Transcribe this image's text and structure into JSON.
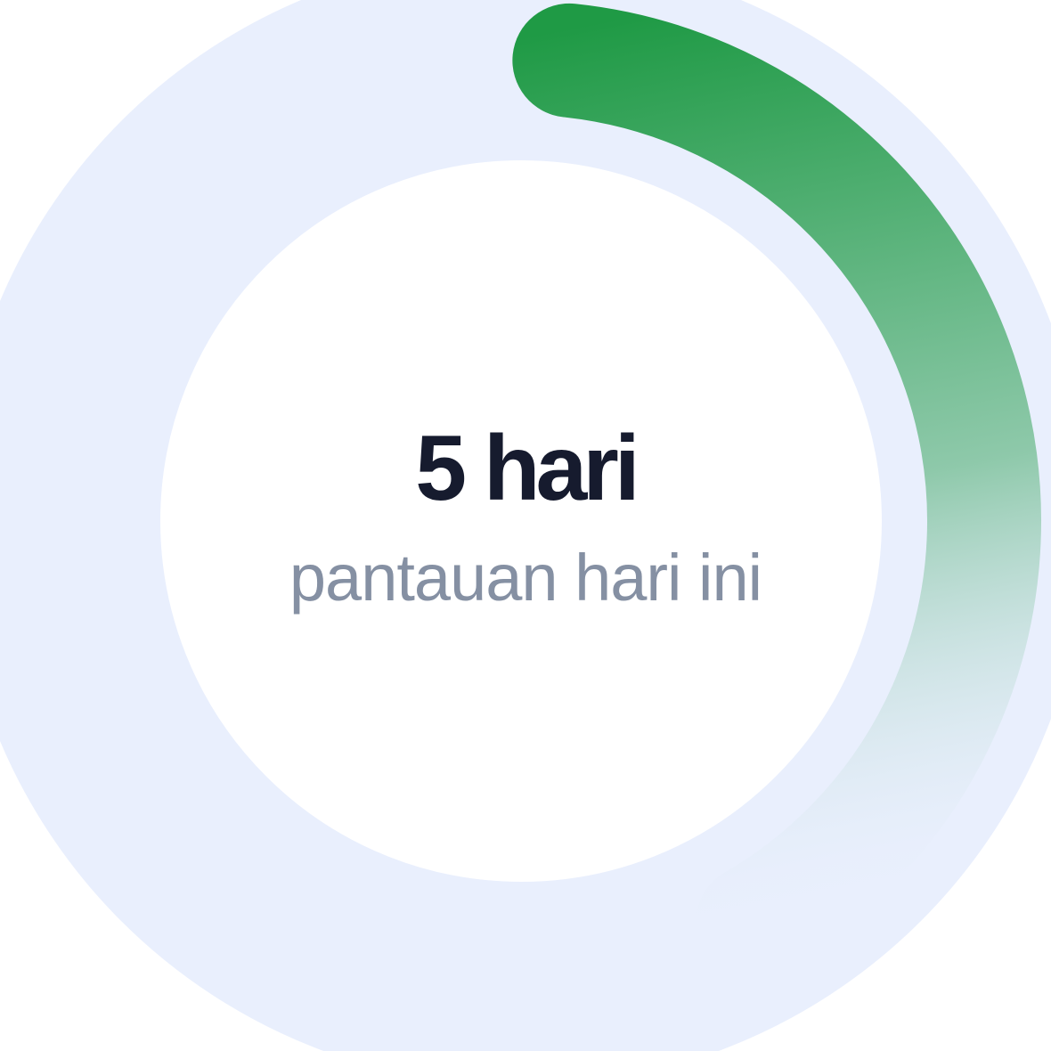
{
  "progress_ring": {
    "value_text": "5 hari",
    "caption": "pantauan hari ini",
    "progress_fraction": 0.4,
    "colors": {
      "track": "#e9effd",
      "arc_start": "#1f9a45",
      "arc_end": "#e9effd",
      "value_text": "#161b2e",
      "caption_text": "#8590a3",
      "background": "#ffffff"
    }
  }
}
